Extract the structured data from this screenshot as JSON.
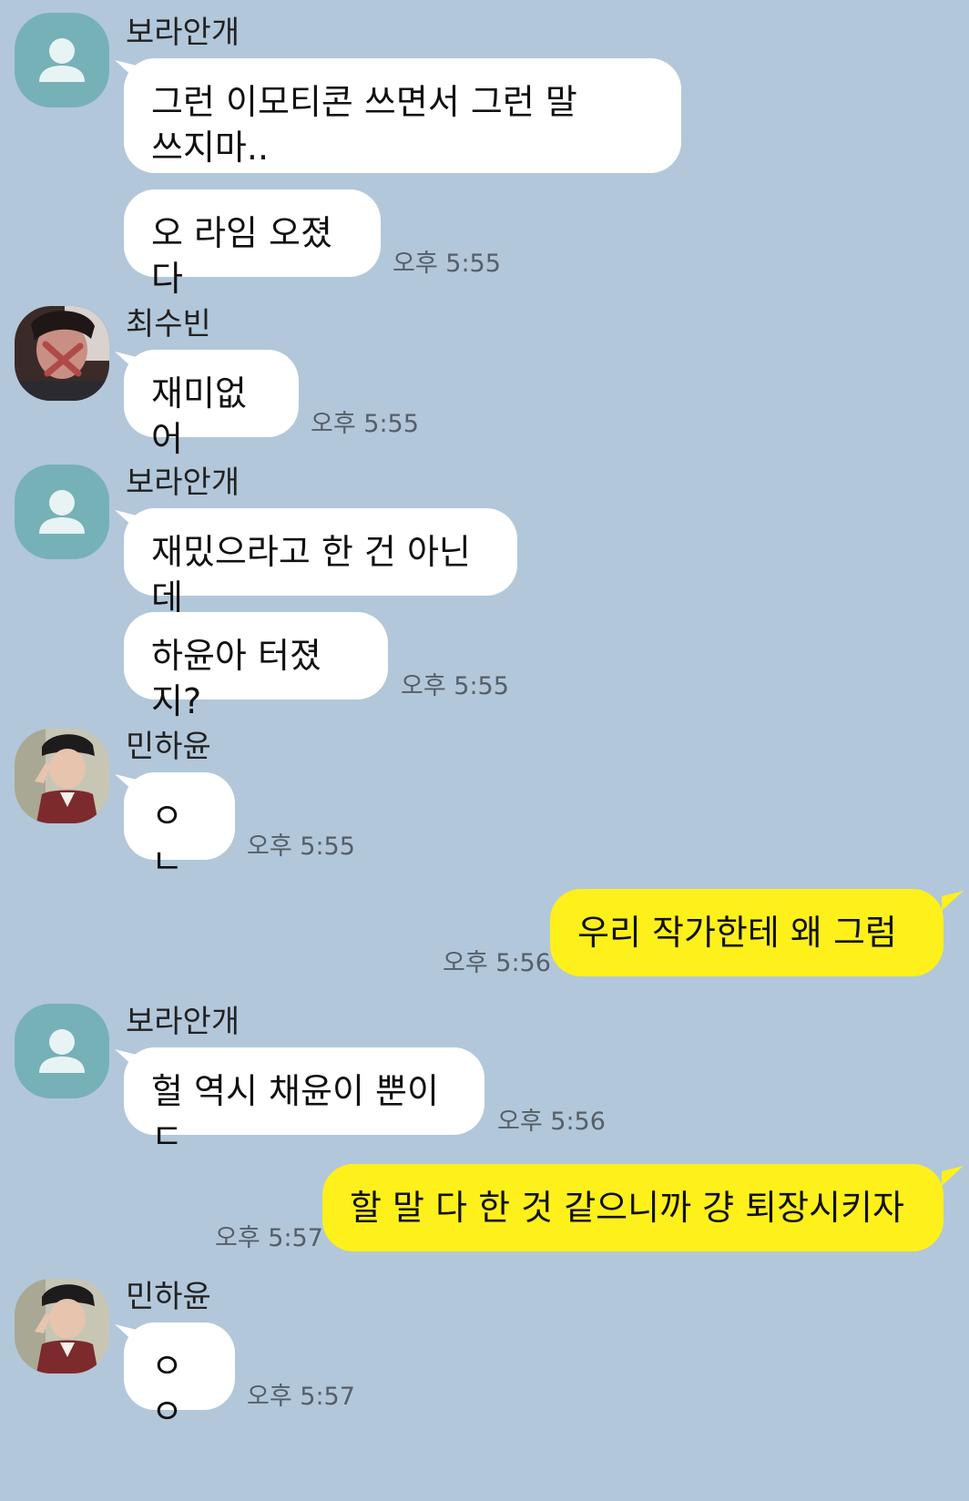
{
  "colors": {
    "background": "#b2c7da",
    "incoming_bubble": "#ffffff",
    "outgoing_bubble": "#fef01b",
    "default_avatar": "#76b1b7"
  },
  "messages": [
    {
      "sender": "보라안개",
      "avatar_icon": "default-profile-icon",
      "text": "그런 이모티콘 쓰면서 그런 말\n쓰지마.."
    },
    {
      "sender": "보라안개",
      "text": "오 라임 오졌다",
      "time": "오후 5:55"
    },
    {
      "sender": "최수빈",
      "avatar_icon": "profile-photo",
      "text": "재미없어",
      "time": "오후 5:55"
    },
    {
      "sender": "보라안개",
      "avatar_icon": "default-profile-icon",
      "text": "재밌으라고 한 건 아닌데"
    },
    {
      "sender": "보라안개",
      "text": "하윤아 터졌지?",
      "time": "오후 5:55"
    },
    {
      "sender": "민하윤",
      "avatar_icon": "profile-photo",
      "text": "ㅇㄴ",
      "time": "오후 5:55"
    },
    {
      "sender": "me",
      "text": "우리 작가한테 왜 그럼",
      "time": "오후 5:56"
    },
    {
      "sender": "보라안개",
      "avatar_icon": "default-profile-icon",
      "text": "헐 역시 채윤이 뿐이ㄷ",
      "time": "오후 5:56"
    },
    {
      "sender": "me",
      "text": "할 말 다 한 것 같으니까 걍 퇴장시키자",
      "time": "오후 5:57"
    },
    {
      "sender": "민하윤",
      "avatar_icon": "profile-photo",
      "text": "ㅇㅇ",
      "time": "오후 5:57"
    }
  ]
}
